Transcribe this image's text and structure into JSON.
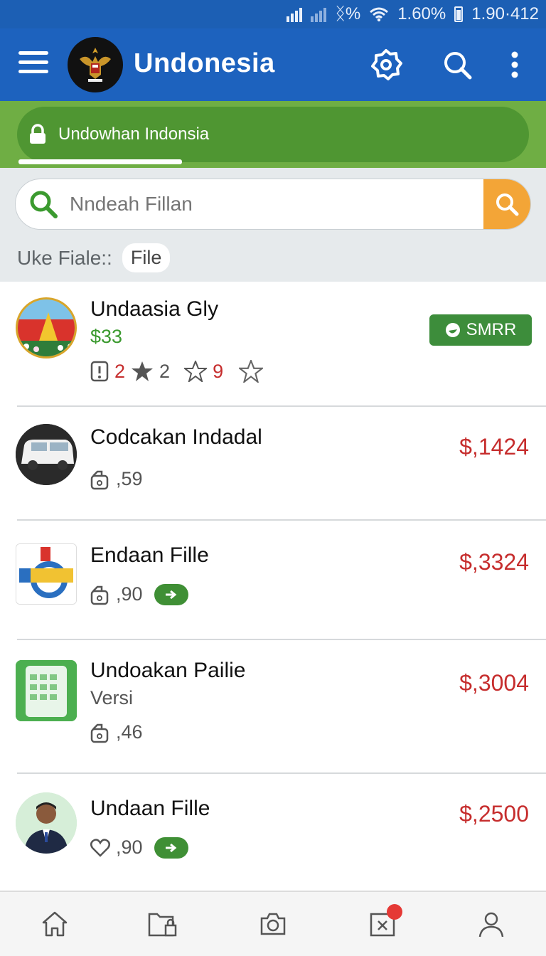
{
  "status_bar": {
    "battery_percent": "1.60%",
    "time": "1.90·412",
    "network_glyph": "ᛝ%"
  },
  "app_bar": {
    "title": "Undonesia",
    "icons": [
      "menu-icon",
      "emblem-logo",
      "settings-icon",
      "search-icon",
      "more-vert-icon"
    ]
  },
  "banner": {
    "text": "Undowhan Indonsia",
    "icon": "lock-icon"
  },
  "search": {
    "placeholder": "Nndeah Fillan",
    "value": ""
  },
  "filter": {
    "label": "Uke Fiale::",
    "chip": "File"
  },
  "items": [
    {
      "title": "Undaasia Gly",
      "price": "$33",
      "badge": "SMRR",
      "stats": {
        "alerts": "2",
        "stars": "2",
        "rating_value": "9"
      }
    },
    {
      "title": "Codcakan Indadal",
      "price": "$,1424",
      "meta": ",59"
    },
    {
      "title": "Endaan Fille",
      "price": "$,3324",
      "meta": ",90"
    },
    {
      "title": "Undoakan Pailie",
      "subtitle": "Versi",
      "price": "$,3004",
      "meta": ",46"
    },
    {
      "title": "Undaan Fille",
      "price": "$,2500",
      "meta": ",90"
    }
  ],
  "bottom_nav": [
    "home-icon",
    "folder-lock-icon",
    "camera-icon",
    "tasks-icon",
    "profile-icon"
  ],
  "colors": {
    "primary": "#1d62be",
    "banner_green": "#6fae44",
    "accent_orange": "#f3a537",
    "price_red": "#c62d2d"
  }
}
